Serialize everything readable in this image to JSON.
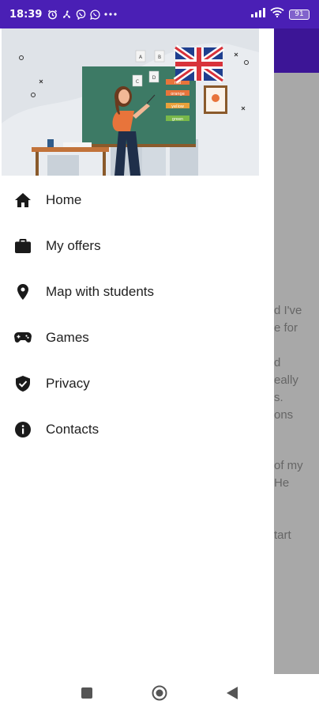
{
  "status_bar": {
    "time": "18:39",
    "battery": "91",
    "background": "#4a1fb5"
  },
  "drawer": {
    "header_image": "teacher-illustration",
    "items": [
      {
        "label": "Home",
        "icon": "home-icon"
      },
      {
        "label": "My offers",
        "icon": "briefcase-icon"
      },
      {
        "label": "Map with students",
        "icon": "location-pin-icon"
      },
      {
        "label": "Games",
        "icon": "gamepad-icon"
      },
      {
        "label": "Privacy",
        "icon": "shield-check-icon"
      },
      {
        "label": "Contacts",
        "icon": "info-icon"
      }
    ]
  },
  "background_app": {
    "toolbar_color": "#3c1596",
    "text_lines": [
      "d I've",
      "e for",
      "d",
      "eally",
      "s.",
      "ons",
      "of my",
      "He",
      "tart"
    ]
  },
  "illustration": {
    "board_words": [
      "red",
      "orange",
      "yellow",
      "green"
    ],
    "cards": [
      "A",
      "B",
      "C",
      "D"
    ]
  },
  "nav_bar": {
    "buttons": [
      "recent-apps",
      "home",
      "back"
    ]
  }
}
